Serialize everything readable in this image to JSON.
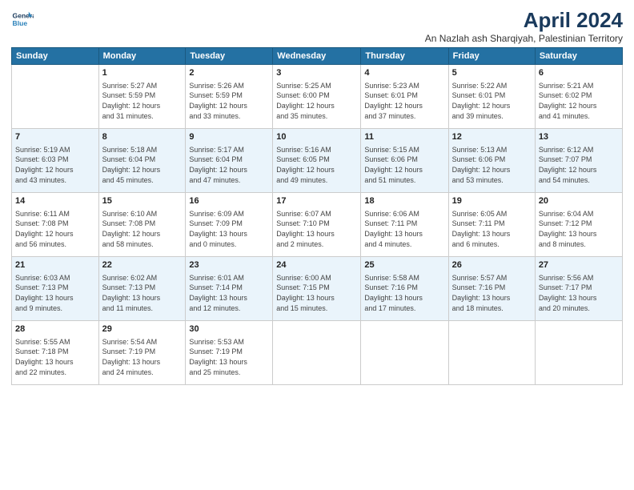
{
  "logo": {
    "line1": "General",
    "line2": "Blue"
  },
  "title": "April 2024",
  "subtitle": "An Nazlah ash Sharqiyah, Palestinian Territory",
  "days_of_week": [
    "Sunday",
    "Monday",
    "Tuesday",
    "Wednesday",
    "Thursday",
    "Friday",
    "Saturday"
  ],
  "weeks": [
    [
      {
        "day": "",
        "info": ""
      },
      {
        "day": "1",
        "info": "Sunrise: 5:27 AM\nSunset: 5:59 PM\nDaylight: 12 hours\nand 31 minutes."
      },
      {
        "day": "2",
        "info": "Sunrise: 5:26 AM\nSunset: 5:59 PM\nDaylight: 12 hours\nand 33 minutes."
      },
      {
        "day": "3",
        "info": "Sunrise: 5:25 AM\nSunset: 6:00 PM\nDaylight: 12 hours\nand 35 minutes."
      },
      {
        "day": "4",
        "info": "Sunrise: 5:23 AM\nSunset: 6:01 PM\nDaylight: 12 hours\nand 37 minutes."
      },
      {
        "day": "5",
        "info": "Sunrise: 5:22 AM\nSunset: 6:01 PM\nDaylight: 12 hours\nand 39 minutes."
      },
      {
        "day": "6",
        "info": "Sunrise: 5:21 AM\nSunset: 6:02 PM\nDaylight: 12 hours\nand 41 minutes."
      }
    ],
    [
      {
        "day": "7",
        "info": "Sunrise: 5:19 AM\nSunset: 6:03 PM\nDaylight: 12 hours\nand 43 minutes."
      },
      {
        "day": "8",
        "info": "Sunrise: 5:18 AM\nSunset: 6:04 PM\nDaylight: 12 hours\nand 45 minutes."
      },
      {
        "day": "9",
        "info": "Sunrise: 5:17 AM\nSunset: 6:04 PM\nDaylight: 12 hours\nand 47 minutes."
      },
      {
        "day": "10",
        "info": "Sunrise: 5:16 AM\nSunset: 6:05 PM\nDaylight: 12 hours\nand 49 minutes."
      },
      {
        "day": "11",
        "info": "Sunrise: 5:15 AM\nSunset: 6:06 PM\nDaylight: 12 hours\nand 51 minutes."
      },
      {
        "day": "12",
        "info": "Sunrise: 5:13 AM\nSunset: 6:06 PM\nDaylight: 12 hours\nand 53 minutes."
      },
      {
        "day": "13",
        "info": "Sunrise: 6:12 AM\nSunset: 7:07 PM\nDaylight: 12 hours\nand 54 minutes."
      }
    ],
    [
      {
        "day": "14",
        "info": "Sunrise: 6:11 AM\nSunset: 7:08 PM\nDaylight: 12 hours\nand 56 minutes."
      },
      {
        "day": "15",
        "info": "Sunrise: 6:10 AM\nSunset: 7:08 PM\nDaylight: 12 hours\nand 58 minutes."
      },
      {
        "day": "16",
        "info": "Sunrise: 6:09 AM\nSunset: 7:09 PM\nDaylight: 13 hours\nand 0 minutes."
      },
      {
        "day": "17",
        "info": "Sunrise: 6:07 AM\nSunset: 7:10 PM\nDaylight: 13 hours\nand 2 minutes."
      },
      {
        "day": "18",
        "info": "Sunrise: 6:06 AM\nSunset: 7:11 PM\nDaylight: 13 hours\nand 4 minutes."
      },
      {
        "day": "19",
        "info": "Sunrise: 6:05 AM\nSunset: 7:11 PM\nDaylight: 13 hours\nand 6 minutes."
      },
      {
        "day": "20",
        "info": "Sunrise: 6:04 AM\nSunset: 7:12 PM\nDaylight: 13 hours\nand 8 minutes."
      }
    ],
    [
      {
        "day": "21",
        "info": "Sunrise: 6:03 AM\nSunset: 7:13 PM\nDaylight: 13 hours\nand 9 minutes."
      },
      {
        "day": "22",
        "info": "Sunrise: 6:02 AM\nSunset: 7:13 PM\nDaylight: 13 hours\nand 11 minutes."
      },
      {
        "day": "23",
        "info": "Sunrise: 6:01 AM\nSunset: 7:14 PM\nDaylight: 13 hours\nand 12 minutes."
      },
      {
        "day": "24",
        "info": "Sunrise: 6:00 AM\nSunset: 7:15 PM\nDaylight: 13 hours\nand 15 minutes."
      },
      {
        "day": "25",
        "info": "Sunrise: 5:58 AM\nSunset: 7:16 PM\nDaylight: 13 hours\nand 17 minutes."
      },
      {
        "day": "26",
        "info": "Sunrise: 5:57 AM\nSunset: 7:16 PM\nDaylight: 13 hours\nand 18 minutes."
      },
      {
        "day": "27",
        "info": "Sunrise: 5:56 AM\nSunset: 7:17 PM\nDaylight: 13 hours\nand 20 minutes."
      }
    ],
    [
      {
        "day": "28",
        "info": "Sunrise: 5:55 AM\nSunset: 7:18 PM\nDaylight: 13 hours\nand 22 minutes."
      },
      {
        "day": "29",
        "info": "Sunrise: 5:54 AM\nSunset: 7:19 PM\nDaylight: 13 hours\nand 24 minutes."
      },
      {
        "day": "30",
        "info": "Sunrise: 5:53 AM\nSunset: 7:19 PM\nDaylight: 13 hours\nand 25 minutes."
      },
      {
        "day": "",
        "info": ""
      },
      {
        "day": "",
        "info": ""
      },
      {
        "day": "",
        "info": ""
      },
      {
        "day": "",
        "info": ""
      }
    ]
  ]
}
